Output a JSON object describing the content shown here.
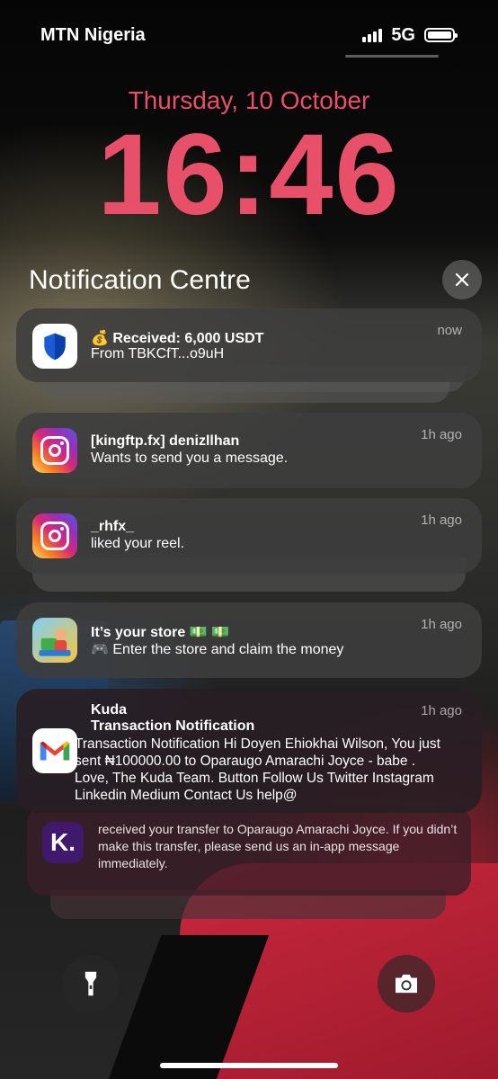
{
  "status_bar": {
    "carrier": "MTN Nigeria",
    "network": "5G",
    "signal_bars": 4,
    "battery_level": 1.0
  },
  "lock_screen": {
    "date": "Thursday, 10 October",
    "time": "16:46",
    "accent_color": "#e8506a"
  },
  "notification_centre": {
    "title": "Notification Centre",
    "close_icon": "close-icon"
  },
  "notifications": [
    {
      "app": "Trust Wallet",
      "icon": "shield-icon",
      "title": "💰 Received: 6,000 USDT",
      "body": "From TBKCfT...o9uH",
      "time": "now"
    },
    {
      "app": "Instagram",
      "icon": "instagram-icon",
      "title": "[kingftp.fx] denizllhan",
      "body": "Wants to send you a message.",
      "time": "1h ago"
    },
    {
      "app": "Instagram",
      "icon": "instagram-icon",
      "title": "_rhfx_",
      "body": "liked your reel.",
      "time": "1h ago"
    },
    {
      "app": "Game",
      "icon": "game-icon",
      "title": "It’s your store 💵 💵",
      "body": "🎮 Enter the store and claim the money",
      "time": "1h ago"
    },
    {
      "app": "Gmail",
      "icon": "gmail-icon",
      "sender": "Kuda",
      "title": "Transaction Notification",
      "body": "Transaction Notification Hi Doyen Ehiokhai Wilson, You just sent ₦100000.00 to Oparaugo Amarachi Joyce - babe . Love, The Kuda Team. Button Follow Us Twitter Instagram Linkedin Medium Contact Us help@",
      "time": "1h ago"
    },
    {
      "app": "Kuda",
      "icon": "kuda-icon",
      "body": "received your transfer to Oparaugo Amarachi Joyce. If you didn’t make this transfer, please send us an in-app message immediately."
    }
  ],
  "quick_actions": {
    "left_icon": "flashlight-icon",
    "right_icon": "camera-icon"
  }
}
